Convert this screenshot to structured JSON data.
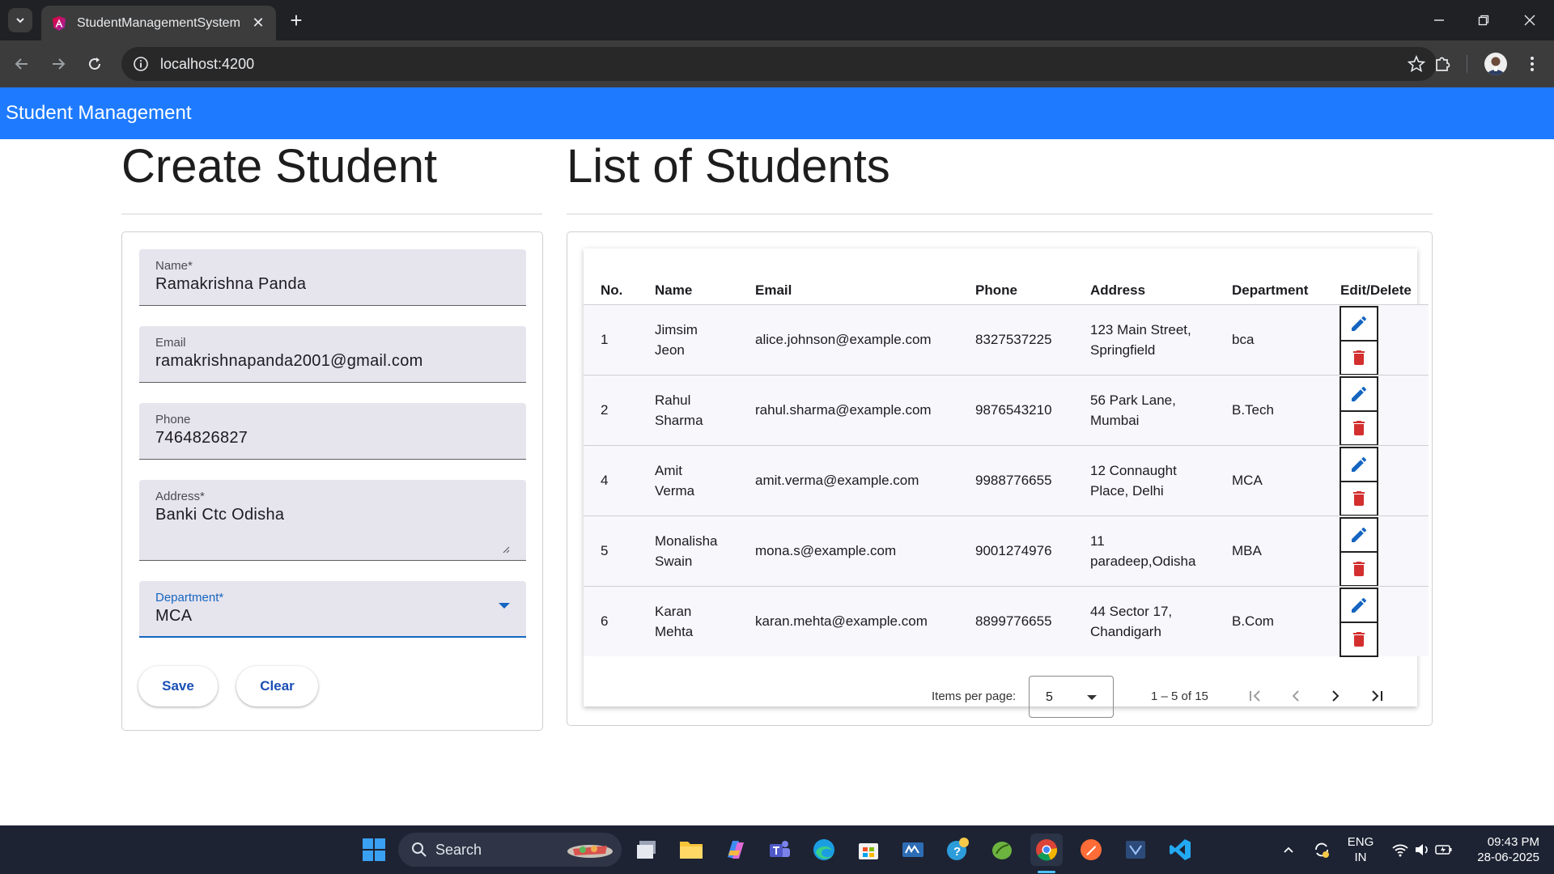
{
  "browser": {
    "tab_title": "StudentManagementSystem",
    "url": "localhost:4200"
  },
  "app": {
    "header_title": "Student Management"
  },
  "create_form": {
    "title": "Create Student",
    "fields": {
      "name": {
        "label": "Name*",
        "value": "Ramakrishna Panda"
      },
      "email": {
        "label": "Email",
        "value": "ramakrishnapanda2001@gmail.com"
      },
      "phone": {
        "label": "Phone",
        "value": "7464826827"
      },
      "address": {
        "label": "Address*",
        "value": "Banki Ctc Odisha"
      },
      "department": {
        "label": "Department*",
        "value": "MCA"
      }
    },
    "save_label": "Save",
    "clear_label": "Clear"
  },
  "student_list": {
    "title": "List of Students",
    "columns": [
      "No.",
      "Name",
      "Email",
      "Phone",
      "Address",
      "Department",
      "Edit/Delete"
    ],
    "rows": [
      {
        "no": "1",
        "name_l1": "Jimsim",
        "name_l2": "Jeon",
        "email": "alice.johnson@example.com",
        "phone": "8327537225",
        "addr_l1": "123 Main Street,",
        "addr_l2": "Springfield",
        "department": "bca"
      },
      {
        "no": "2",
        "name_l1": "Rahul",
        "name_l2": "Sharma",
        "email": "rahul.sharma@example.com",
        "phone": "9876543210",
        "addr_l1": "56 Park Lane,",
        "addr_l2": "Mumbai",
        "department": "B.Tech"
      },
      {
        "no": "4",
        "name_l1": "Amit",
        "name_l2": "Verma",
        "email": "amit.verma@example.com",
        "phone": "9988776655",
        "addr_l1": "12 Connaught",
        "addr_l2": "Place, Delhi",
        "department": "MCA"
      },
      {
        "no": "5",
        "name_l1": "Monalisha",
        "name_l2": "Swain",
        "email": "mona.s@example.com",
        "phone": "9001274976",
        "addr_l1": "11",
        "addr_l2": "paradeep,Odisha",
        "department": "MBA"
      },
      {
        "no": "6",
        "name_l1": "Karan",
        "name_l2": "Mehta",
        "email": "karan.mehta@example.com",
        "phone": "8899776655",
        "addr_l1": "44 Sector 17,",
        "addr_l2": "Chandigarh",
        "department": "B.Com"
      }
    ],
    "paginator": {
      "items_per_page_label": "Items per page:",
      "page_size": "5",
      "range_label": "1 – 5 of 15"
    }
  },
  "taskbar": {
    "search_label": "Search",
    "language_line1": "ENG",
    "language_line2": "IN",
    "time": "09:43 PM",
    "date": "28-06-2025"
  },
  "colors": {
    "app_header": "#1e7bff",
    "edit_icon": "#1565c0",
    "delete_icon": "#d32f2f",
    "button_text": "#1a4fb5"
  }
}
